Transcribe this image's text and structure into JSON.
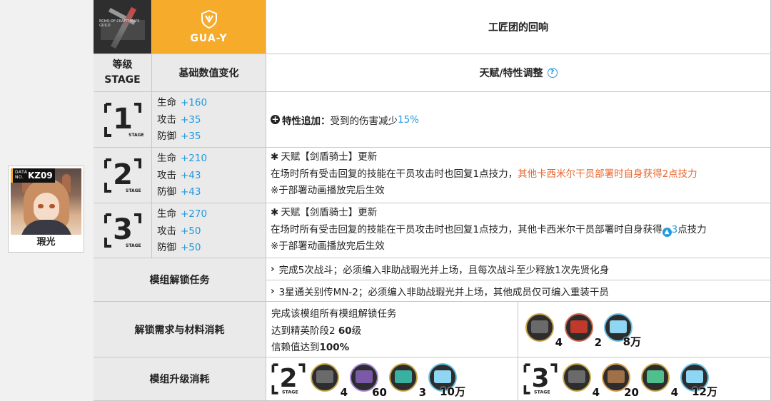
{
  "operator": {
    "code": "KZ09",
    "tag_small": "DATA NO.",
    "name": "瑕光"
  },
  "module": {
    "image_caption": "ECHO OF CRAFTMAN'S GUILD",
    "type_code": "GUA-Y",
    "title": "工匠团的回响"
  },
  "headers": {
    "level_cn": "等级",
    "level_en": "STAGE",
    "stats": "基础数值变化",
    "talent": "天赋/特性调整",
    "help": "?"
  },
  "stages": [
    {
      "label": "1",
      "stats": [
        {
          "name": "生命",
          "value": "+160"
        },
        {
          "name": "攻击",
          "value": "+35"
        },
        {
          "name": "防御",
          "value": "+35"
        }
      ],
      "trait_label": "特性追加：",
      "trait_text": "受到的伤害减少",
      "trait_value": "15%"
    },
    {
      "label": "2",
      "stats": [
        {
          "name": "生命",
          "value": "+210"
        },
        {
          "name": "攻击",
          "value": "+43"
        },
        {
          "name": "防御",
          "value": "+43"
        }
      ],
      "line1": "天赋【剑盾骑士】更新",
      "line2": "在场时所有受击回复的技能在干员攻击时也回复1点技力，",
      "line2_highlight": "其他卡西米尔干员部署时自身获得2点技力",
      "line3": "※于部署动画播放完后生效"
    },
    {
      "label": "3",
      "stats": [
        {
          "name": "生命",
          "value": "+270"
        },
        {
          "name": "攻击",
          "value": "+50"
        },
        {
          "name": "防御",
          "value": "+50"
        }
      ],
      "line1": "天赋【剑盾骑士】更新",
      "line2": "在场时所有受击回复的技能在干员攻击时也回复1点技力，其他卡西米尔干员部署时自身获得",
      "line2_value": "3",
      "line2_tail": "点技力",
      "line3": "※于部署动画播放完后生效"
    }
  ],
  "tasks": {
    "label": "模组解锁任务",
    "items": [
      "完成5次战斗；必须编入非助战瑕光并上场，且每次战斗至少释放1次先贤化身",
      "3星通关别传MN-2；必须编入非助战瑕光并上场，其他成员仅可编入重装干员"
    ]
  },
  "unlock": {
    "label": "解锁需求与材料消耗",
    "req1": "完成该模组所有模组解锁任务",
    "req2_prefix": "达到精英阶段2 ",
    "req2_value": "60",
    "req2_suffix": "级",
    "req3_prefix": "信赖值达到",
    "req3_value": "100%",
    "materials": [
      {
        "icon": "module-data-block-icon",
        "qty": "4"
      },
      {
        "icon": "red-chip-icon",
        "qty": "2"
      },
      {
        "icon": "lmd-icon",
        "qty": "8万"
      }
    ]
  },
  "upgrade": {
    "label": "模组升级消耗",
    "stage2": [
      {
        "icon": "module-data-block-icon",
        "qty": "4"
      },
      {
        "icon": "purple-material-icon",
        "qty": "60"
      },
      {
        "icon": "teal-material-icon",
        "qty": "3"
      },
      {
        "icon": "lmd-icon",
        "qty": "10万"
      }
    ],
    "stage3": [
      {
        "icon": "module-data-block-icon",
        "qty": "4"
      },
      {
        "icon": "gear-material-icon",
        "qty": "20"
      },
      {
        "icon": "green-material-icon",
        "qty": "4"
      },
      {
        "icon": "lmd-icon",
        "qty": "12万"
      }
    ]
  },
  "colors": {
    "accent_blue": "#2299dd",
    "accent_orange": "#f6ab2a",
    "highlight_red": "#e8662d"
  }
}
